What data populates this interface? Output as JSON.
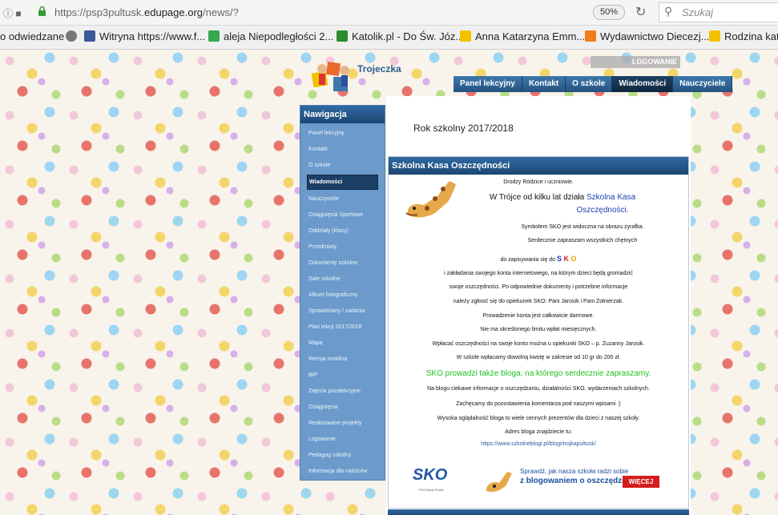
{
  "browser": {
    "url_prefix": "https://psp3pultusk.",
    "url_domain": "edupage.org",
    "url_suffix": "/news/?",
    "zoom": "50%",
    "search_placeholder": "Szukaj"
  },
  "bookmarks": [
    {
      "label": "o odwiedzane",
      "color": "#f0f0f0"
    },
    {
      "label": "Witryna https://www.f...",
      "color": "#3b5998"
    },
    {
      "label": "aleja Niepodległości 2...",
      "color": "#34a853"
    },
    {
      "label": "Katolik.pl - Do Św. Józ...",
      "color": "#2e8b2e"
    },
    {
      "label": "Anna Katarzyna Emm...",
      "color": "#f2c200"
    },
    {
      "label": "Wydawnictwo Diecezj...",
      "color": "#f07d1a"
    },
    {
      "label": "Rodzina kato",
      "color": "#f2c200"
    }
  ],
  "site": {
    "title": "Trojeczka",
    "login": "LOGOWANIE",
    "topnav": [
      "Panel lekcyjny",
      "Kontakt",
      "O szkole",
      "Wiadomości",
      "Nauczyciele"
    ],
    "topnav_active": 3
  },
  "sidebar": {
    "heading": "Nawigacja",
    "items": [
      "Panel lekcyjny",
      "Kontakt",
      "O szkole",
      "Wiadomości",
      "Nauczyciele",
      "Osiągnięcia Sportowe",
      "Oddziały (klasy)",
      "Przedmioty",
      "Dokumenty szkolne",
      "Sale szkolne",
      "Album fotograficzny",
      "Sprawdziany / zadania",
      "Plan lekcji 2017/2018",
      "Mapa",
      "Wersja mobilna",
      "BIP",
      "Zajęcia pozalekcyjne",
      "Osiągnięcia",
      "Realizowane projekty",
      "Logowanie",
      "Pedagog szkolny",
      "Informacja dla rodziców"
    ],
    "active_index": 3
  },
  "main": {
    "year_title": "Rok szkolny 2017/2018",
    "article": {
      "heading": "Szkolna Kasa Oszczędności",
      "greeting": "Drodzy Rodzice i uczniowie.",
      "lead_1a": "W Trójce od kilku lat działa ",
      "lead_1b": "Szkolna Kasa",
      "lead_2": "Oszczędności.",
      "symbol": "Symbolem SKO jest widoczna na obrazu żyrafka.",
      "invite": "Serdecznie zapraszam wszystkich chętnych",
      "signup": "do zapisywania się do",
      "sko_s": "S",
      "sko_k": "K",
      "sko_o": "O",
      "line_accounts": "i zakładania swojego konta internetowego, na którym dzieci będą gromadzić",
      "line_savings": "swoje oszczędności. Po odpowiednie dokumenty i potrzebne informacje",
      "line_contact": "należy zgłosić się do opiekunek SKO: Pani Jarosik i Pani Żołnierzak.",
      "line_free": "Prowadzenie konta jest całkowicie darmowe.",
      "line_limit": "Nie ma określonego limitu wpłat miesięcznych.",
      "line_deposit": "Wpłacać oszczędności na swoje konto można u opiekunki SKO – p. Zuzanny Jarosik.",
      "line_range": "W szkole wpłacamy dowolną kwotę w zakresie od 10 gr do 200 zł.",
      "line_blog": "SKO prowadzi także bloga, na którego serdecznie zapraszamy.",
      "line_blog_info": "Na blogu ciekawe informacje o oszczędzaniu, działalności SKO, wydarzeniach szkolnych.",
      "line_comment": "Zachęcamy do pozostawienia komentarza pod naszymi wpisami :)",
      "line_popular": "Wysoka oglądalność bloga to wiele cennych prezentów dla dzieci z naszej szkoły.",
      "line_address": "Adres bloga znajdziecie tu:",
      "blog_url": "https://www.szkolneblogi.pl/blogi/trojkapultusk/"
    },
    "banner": {
      "logo": "SKO",
      "logo_sub": "PKO Bank Polski",
      "text_1": "Sprawdź, jak nasza szkoła radzi sobie",
      "text_2": "z blogowaniem o oszczędzaniu!",
      "button": "WIĘCEJ"
    }
  }
}
